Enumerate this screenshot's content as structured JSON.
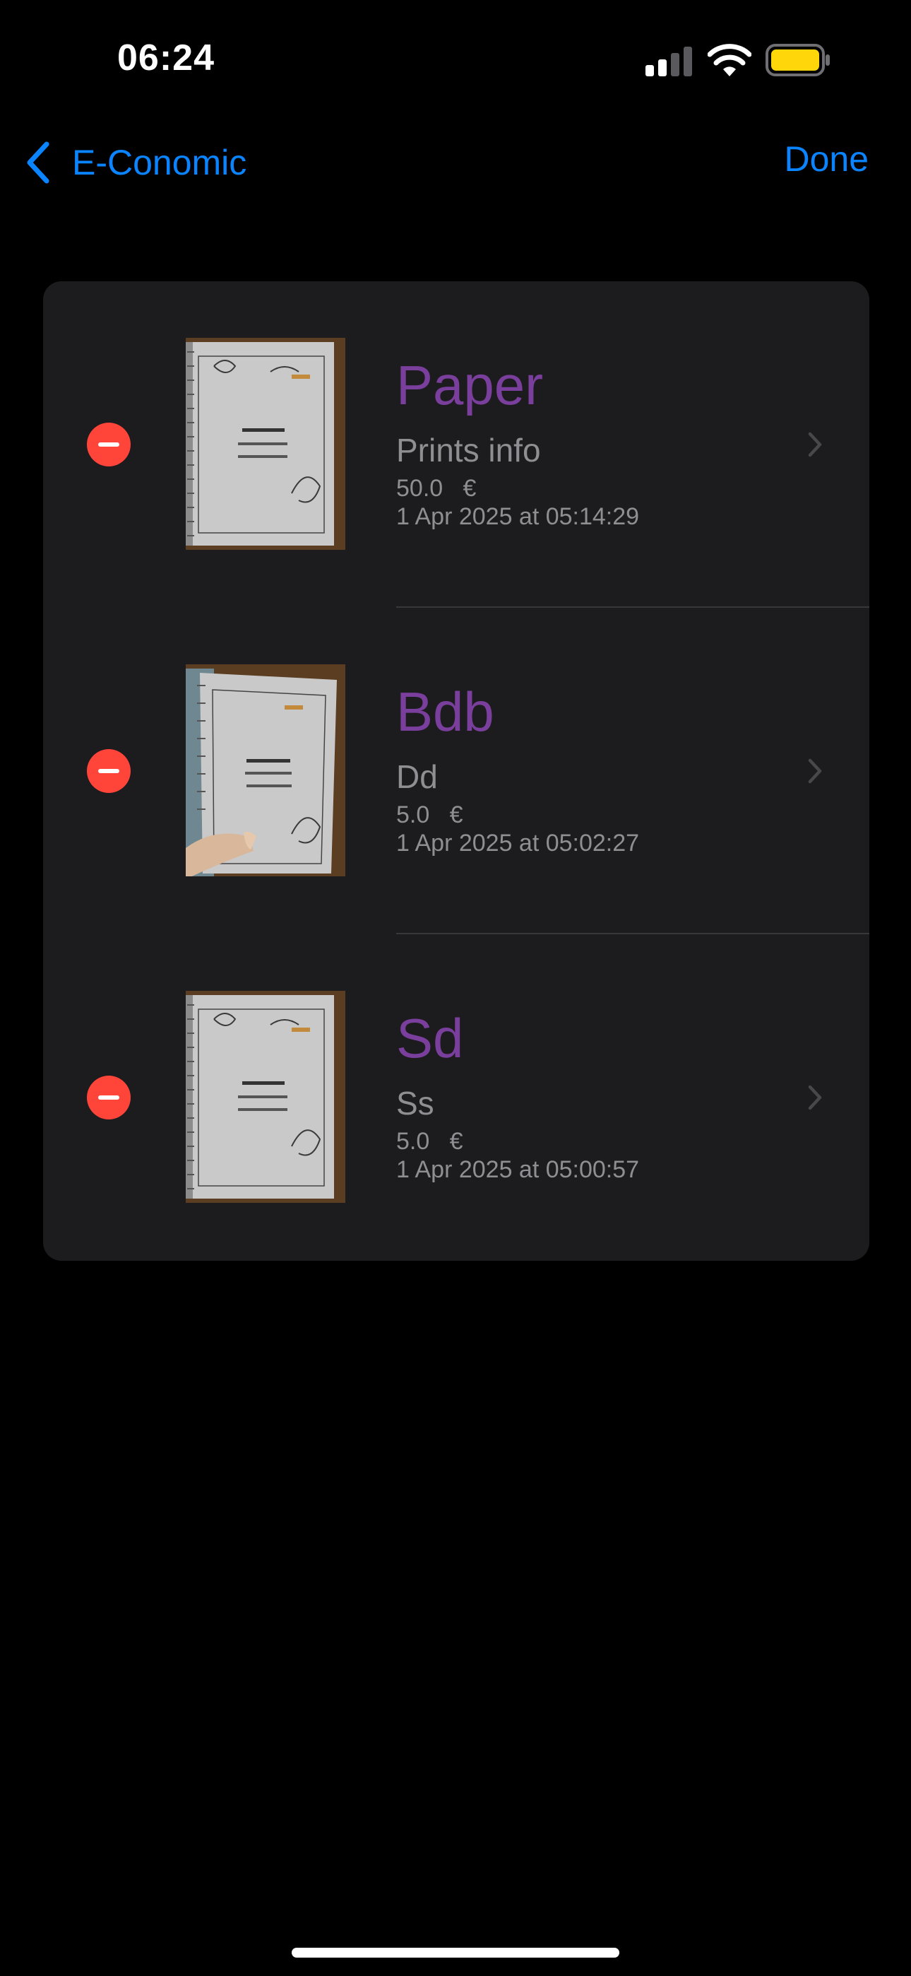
{
  "status_bar": {
    "time": "06:24",
    "icons": [
      "cellular-signal-icon",
      "wifi-icon",
      "battery-icon"
    ],
    "battery_color": "#ffd60a"
  },
  "nav": {
    "back_label": "E-Conomic",
    "back_icon": "chevron-left-icon",
    "done_label": "Done",
    "accent_color": "#0a84ff"
  },
  "list": {
    "title_color": "#7a3f9d",
    "items": [
      {
        "title": "Paper",
        "subtitle": "Prints info",
        "amount": "50.0   €",
        "date": "1 Apr 2025 at 05:14:29",
        "thumbnail_icon": "receipt-photo-icon"
      },
      {
        "title": "Bdb",
        "subtitle": "Dd",
        "amount": "5.0   €",
        "date": "1 Apr 2025 at 05:02:27",
        "thumbnail_icon": "receipt-photo-icon"
      },
      {
        "title": "Sd",
        "subtitle": "Ss",
        "amount": "5.0   €",
        "date": "1 Apr 2025 at 05:00:57",
        "thumbnail_icon": "receipt-photo-icon"
      }
    ]
  }
}
